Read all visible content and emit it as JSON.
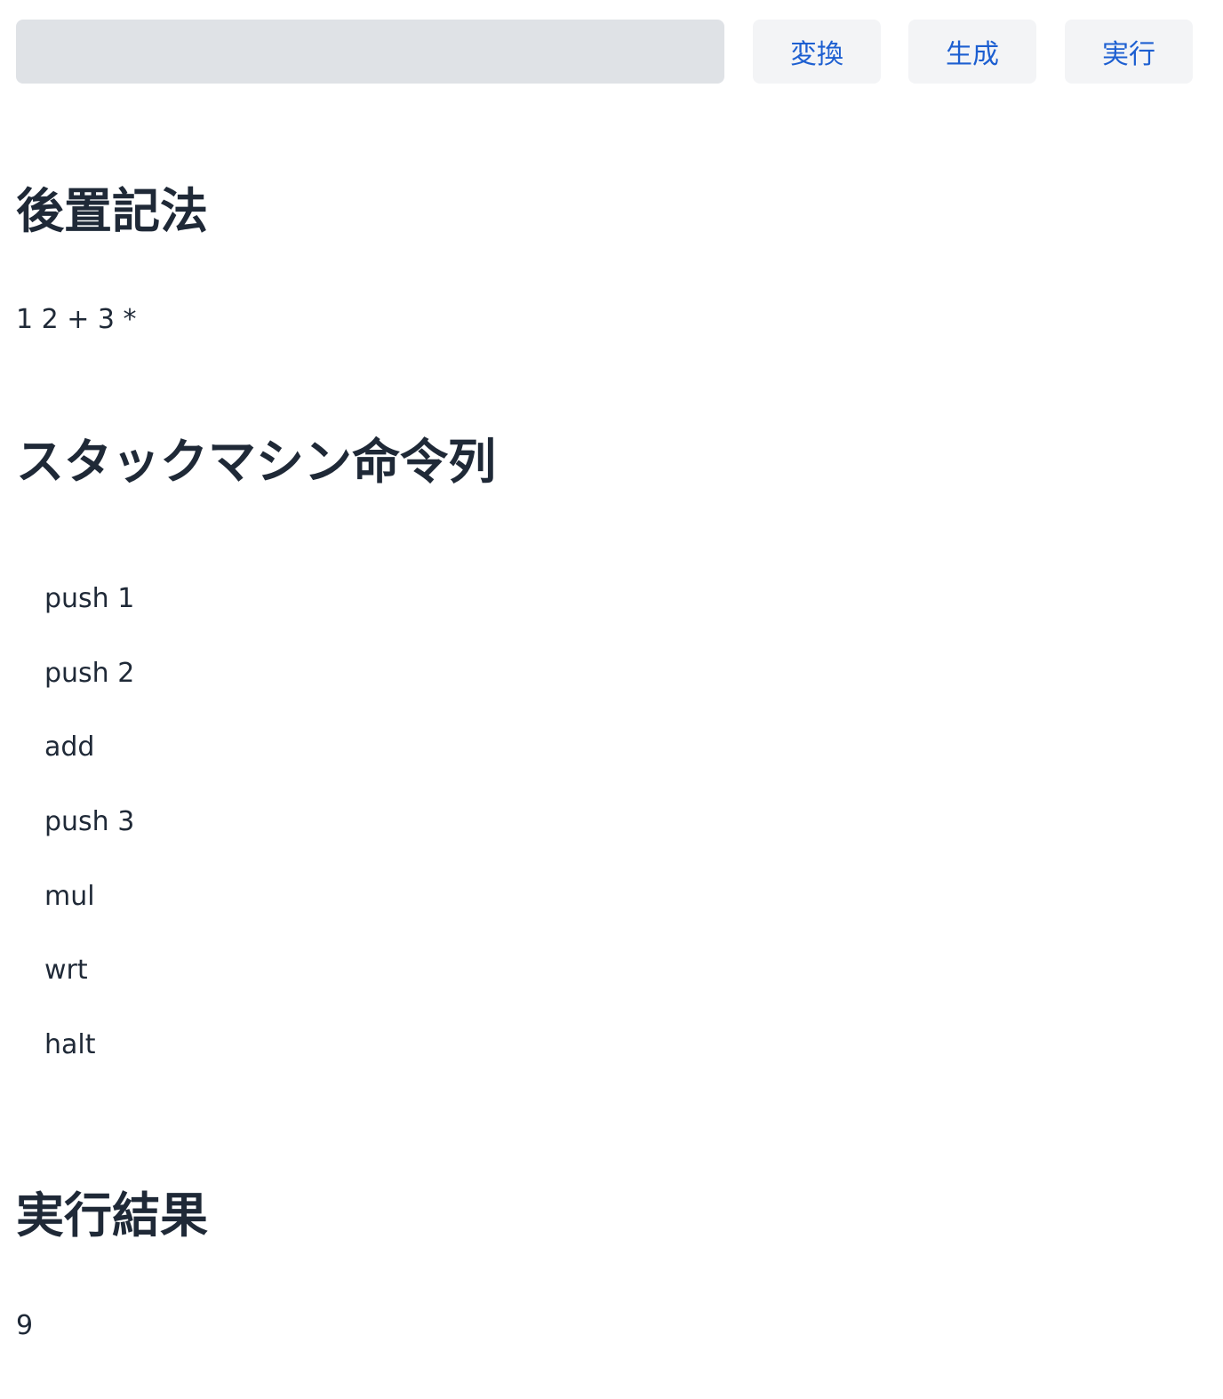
{
  "toolbar": {
    "input_value": "",
    "input_placeholder": "",
    "convert_label": "変換",
    "generate_label": "生成",
    "execute_label": "実行"
  },
  "postfix": {
    "heading": "後置記法",
    "value": "1 2 + 3 *"
  },
  "instructions": {
    "heading": "スタックマシン命令列",
    "items": [
      "push 1",
      "push 2",
      "add",
      "push 3",
      "mul",
      "wrt",
      "halt"
    ]
  },
  "result": {
    "heading": "実行結果",
    "value": "9"
  },
  "colors": {
    "input_background": "#dfe2e6",
    "button_background": "#f3f4f6",
    "button_text": "#1d5fd1",
    "text": "#1f2937"
  }
}
